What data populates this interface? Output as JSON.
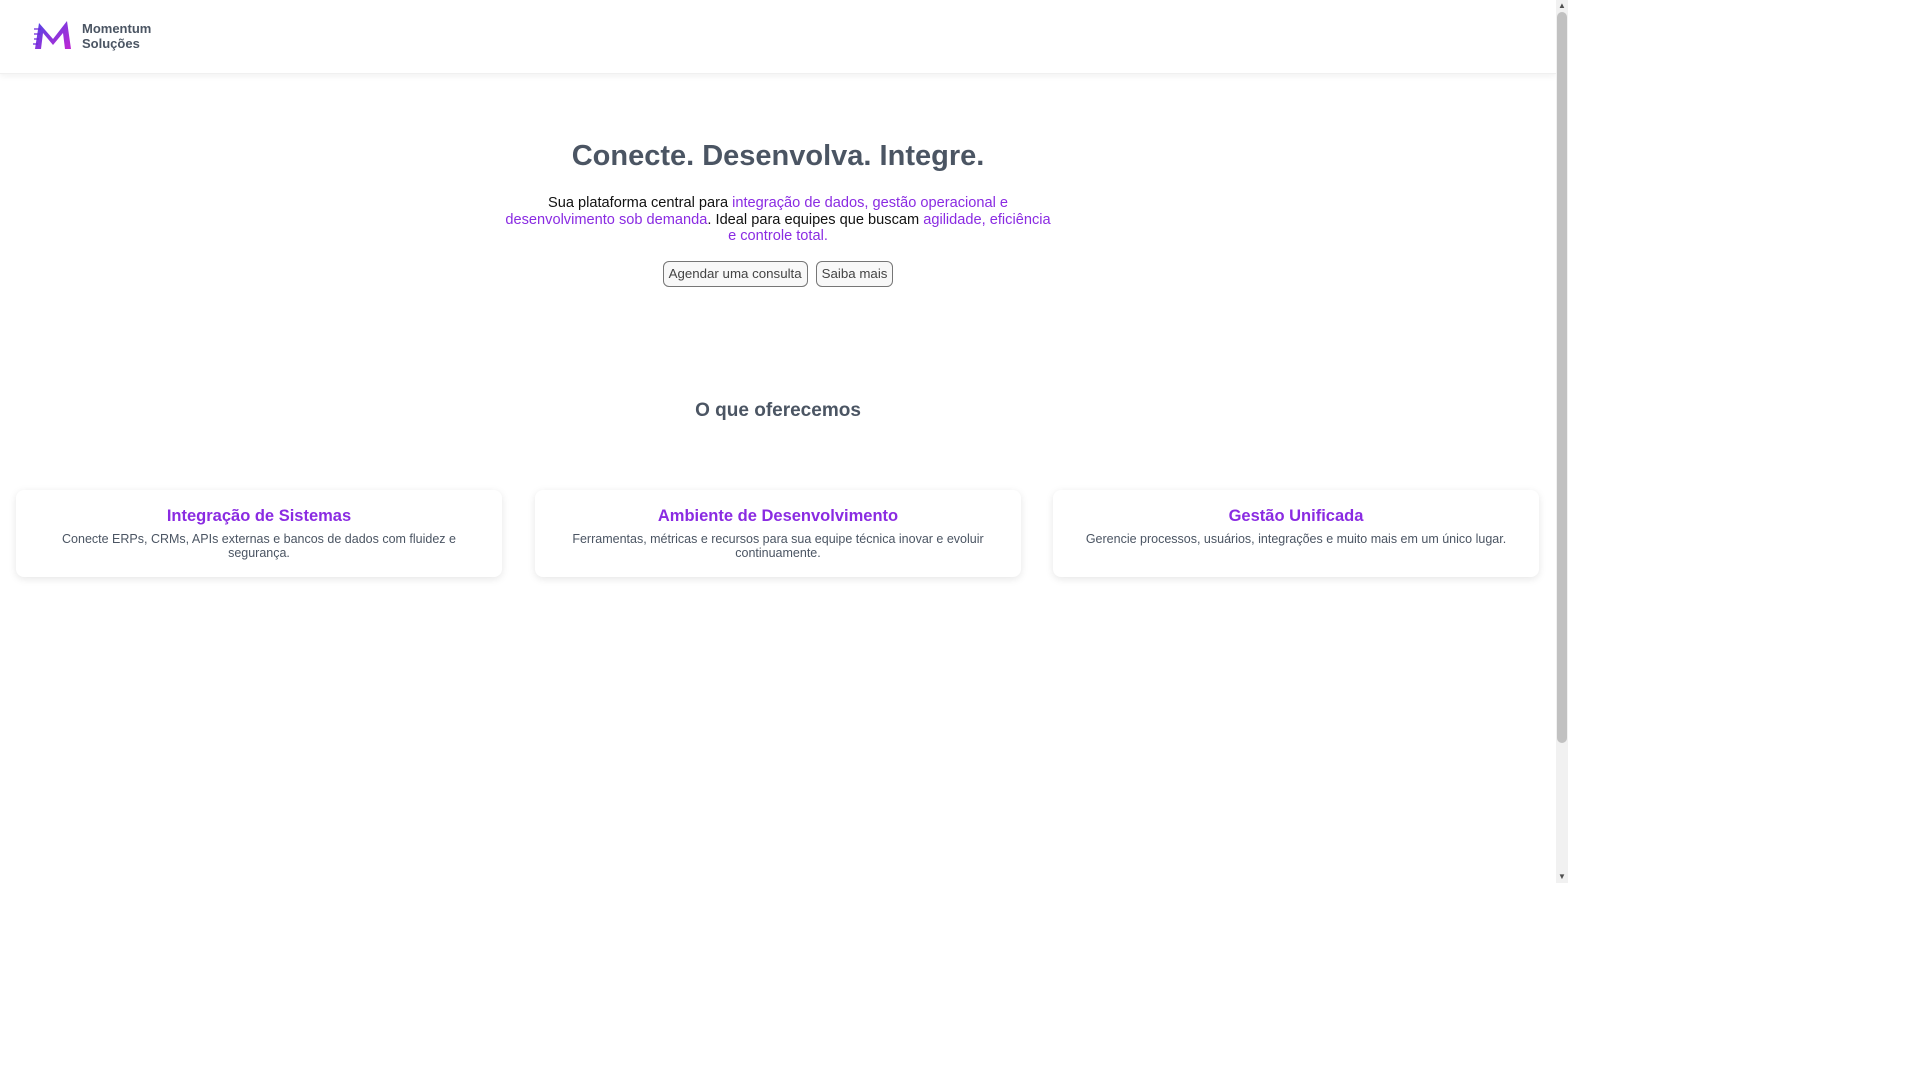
{
  "brand": {
    "line1": "Momentum",
    "line2": "Soluções"
  },
  "hero": {
    "title": "Conecte. Desenvolva. Integre.",
    "text_part1": "Sua plataforma central para ",
    "text_highlight1": "integração de dados, gestão operacional e desenvolvimento sob demanda",
    "text_part2": ". Ideal para equipes que buscam ",
    "text_highlight2": "agilidade, eficiência e controle total.",
    "primary_button": "Agendar uma consulta",
    "secondary_button": "Saiba mais"
  },
  "offerings": {
    "title": "O que oferecemos",
    "cards": [
      {
        "title": "Integração de Sistemas",
        "text": "Conecte ERPs, CRMs, APIs externas e bancos de dados com fluidez e segurança."
      },
      {
        "title": "Ambiente de Desenvolvimento",
        "text": "Ferramentas, métricas e recursos para sua equipe técnica inovar e evoluir continuamente."
      },
      {
        "title": "Gestão Unificada",
        "text": "Gerencie processos, usuários, integrações e muito mais em um único lugar."
      }
    ]
  },
  "colors": {
    "accent": "#8a2be2",
    "heading": "#4b5563",
    "logo_gradient_start": "#4f46e5",
    "logo_gradient_end": "#c026d3"
  },
  "icons": {
    "logo": "momentum-m-logo"
  }
}
